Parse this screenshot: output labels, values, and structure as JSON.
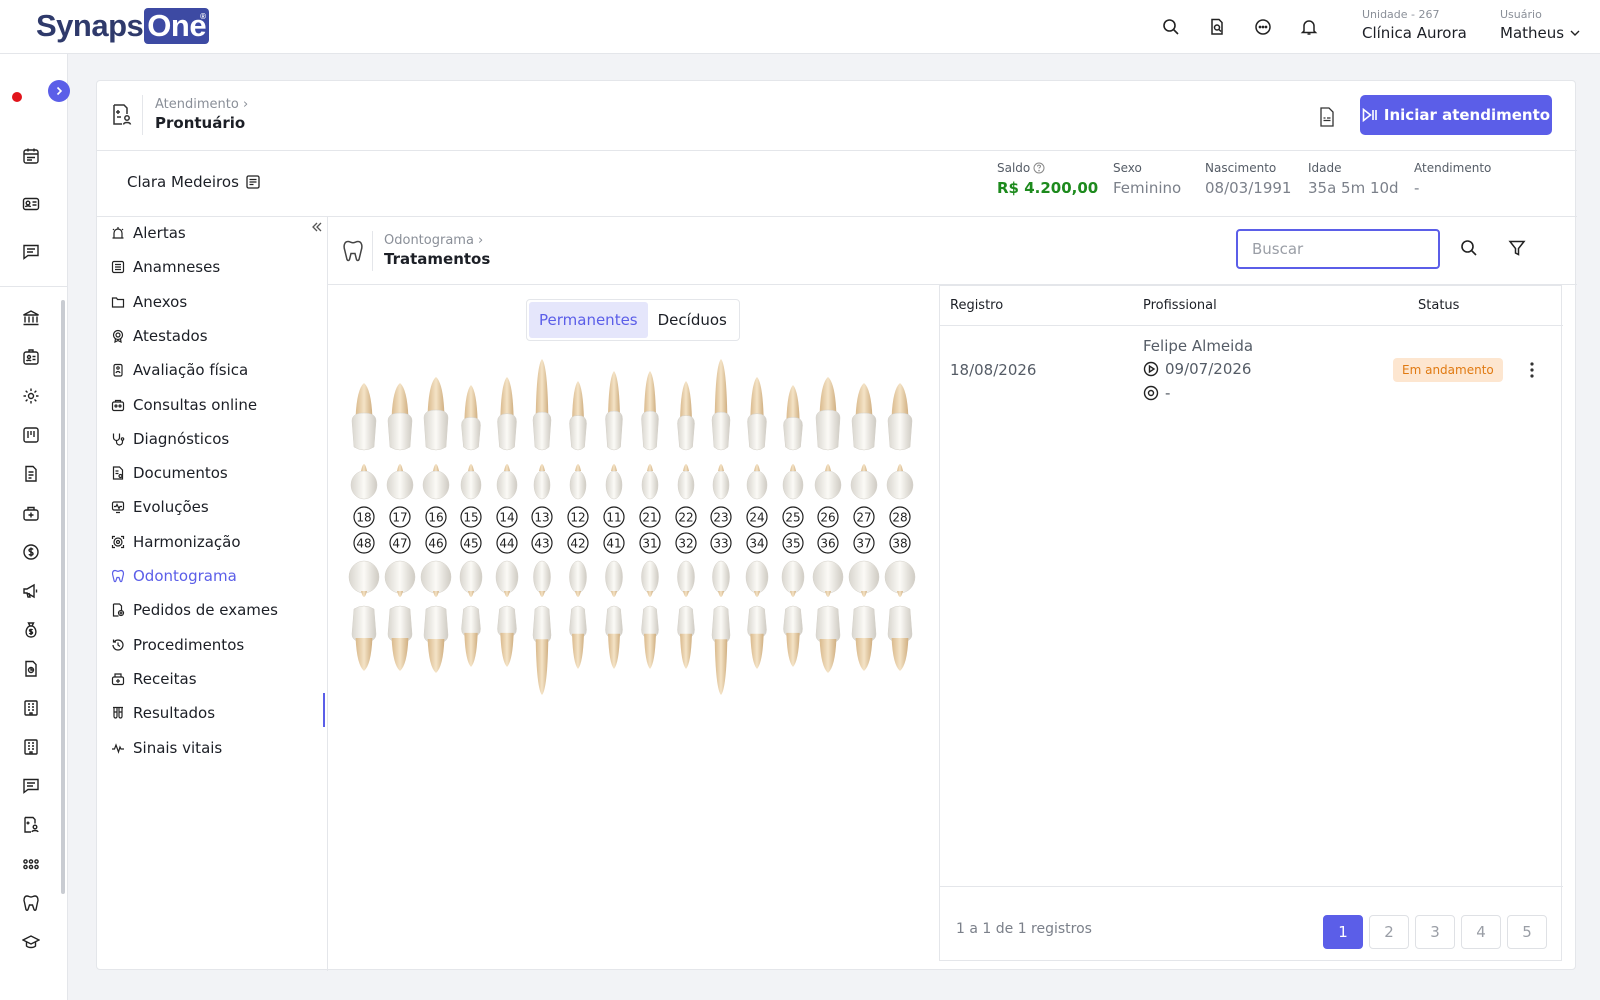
{
  "brand": {
    "part1": "Synaps",
    "part2": "One",
    "mark": "®"
  },
  "topbar": {
    "unit_label": "Unidade - 267",
    "unit_name": "Clínica Aurora",
    "user_label": "Usuário",
    "user_name": "Matheus"
  },
  "header": {
    "breadcrumb": "Atendimento",
    "title": "Prontuário",
    "start_button": "Iniciar atendimento"
  },
  "patient": {
    "name": "Clara Medeiros",
    "balance_label": "Saldo",
    "balance": "R$ 4.200,00",
    "sex_label": "Sexo",
    "sex": "Feminino",
    "birth_label": "Nascimento",
    "birth": "08/03/1991",
    "age_label": "Idade",
    "age": "35a 5m 10d",
    "attendance_label": "Atendimento",
    "attendance": "-"
  },
  "sidenav": {
    "items": [
      {
        "label": "Alertas",
        "icon": "alarm-icon"
      },
      {
        "label": "Anamneses",
        "icon": "list-icon"
      },
      {
        "label": "Anexos",
        "icon": "folder-icon"
      },
      {
        "label": "Atestados",
        "icon": "certificate-icon"
      },
      {
        "label": "Avaliação física",
        "icon": "body-icon"
      },
      {
        "label": "Consultas online",
        "icon": "video-icon"
      },
      {
        "label": "Diagnósticos",
        "icon": "stethoscope-icon"
      },
      {
        "label": "Documentos",
        "icon": "document-icon"
      },
      {
        "label": "Evoluções",
        "icon": "monitor-icon"
      },
      {
        "label": "Harmonização",
        "icon": "face-icon"
      },
      {
        "label": "Odontograma",
        "icon": "tooth-icon"
      },
      {
        "label": "Pedidos de exames",
        "icon": "exam-icon"
      },
      {
        "label": "Procedimentos",
        "icon": "history-icon"
      },
      {
        "label": "Receitas",
        "icon": "pill-icon"
      },
      {
        "label": "Resultados",
        "icon": "tubes-icon"
      },
      {
        "label": "Sinais vitais",
        "icon": "pulse-icon"
      }
    ],
    "active": "Odontograma"
  },
  "content": {
    "breadcrumb": "Odontograma",
    "title": "Tratamentos",
    "search_placeholder": "Buscar"
  },
  "dentition": {
    "tabs": [
      "Permanentes",
      "Decíduos"
    ],
    "active_tab": "Permanentes",
    "upper": [
      "18",
      "17",
      "16",
      "15",
      "14",
      "13",
      "12",
      "11",
      "21",
      "22",
      "23",
      "24",
      "25",
      "26",
      "27",
      "28"
    ],
    "lower": [
      "48",
      "47",
      "46",
      "45",
      "44",
      "43",
      "42",
      "41",
      "31",
      "32",
      "33",
      "34",
      "35",
      "36",
      "37",
      "38"
    ]
  },
  "table": {
    "columns": [
      "Registro",
      "Profissional",
      "Status"
    ],
    "rows": [
      {
        "registro": "18/08/2026",
        "profissional": "Felipe Almeida",
        "inicio": "09/07/2026",
        "fim": "-",
        "status": "Em andamento"
      }
    ],
    "summary": "1 a 1 de 1 registros",
    "pages": [
      "1",
      "2",
      "3",
      "4",
      "5"
    ],
    "current_page": "1"
  },
  "colors": {
    "accent": "#5b5ee8",
    "balance": "#1d8a1d",
    "status_bg": "#fde6d0",
    "status_text": "#e07a12"
  }
}
